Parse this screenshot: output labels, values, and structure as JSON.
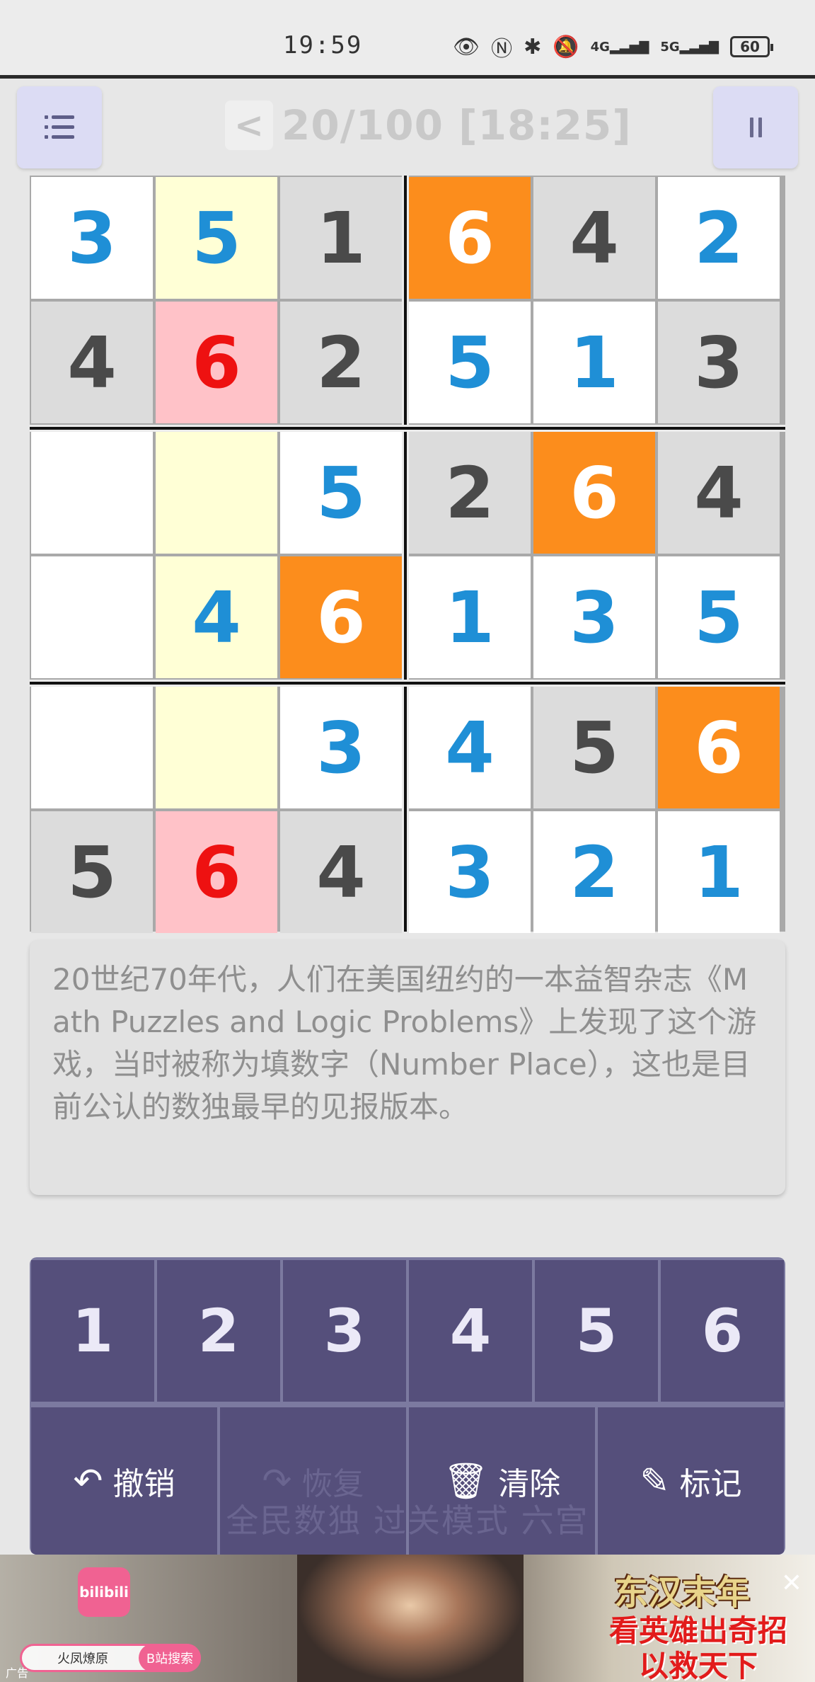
{
  "status_bar": {
    "time": "19:59",
    "network_4g": "4G",
    "network_5g": "5G",
    "battery": "60"
  },
  "header": {
    "back_label": "<",
    "progress": "20/100 [18:25]"
  },
  "board": {
    "size": 6,
    "cells": [
      [
        {
          "v": "3",
          "bg": "#ffffff",
          "fg": "#1f8fd6"
        },
        {
          "v": "5",
          "bg": "#ffffd6",
          "fg": "#1f8fd6"
        },
        {
          "v": "1",
          "bg": "#dcdcdc",
          "fg": "#4a4a4a"
        },
        {
          "v": "6",
          "bg": "#fc8d1c",
          "fg": "#ffffff"
        },
        {
          "v": "4",
          "bg": "#dcdcdc",
          "fg": "#4a4a4a"
        },
        {
          "v": "2",
          "bg": "#ffffff",
          "fg": "#1f8fd6"
        }
      ],
      [
        {
          "v": "4",
          "bg": "#dcdcdc",
          "fg": "#4a4a4a"
        },
        {
          "v": "6",
          "bg": "#ffc2c8",
          "fg": "#ee1111"
        },
        {
          "v": "2",
          "bg": "#dcdcdc",
          "fg": "#4a4a4a"
        },
        {
          "v": "5",
          "bg": "#ffffff",
          "fg": "#1f8fd6"
        },
        {
          "v": "1",
          "bg": "#ffffff",
          "fg": "#1f8fd6"
        },
        {
          "v": "3",
          "bg": "#dcdcdc",
          "fg": "#4a4a4a"
        }
      ],
      [
        {
          "v": "",
          "bg": "#ffffff",
          "fg": "#1f8fd6"
        },
        {
          "v": "",
          "bg": "#ffffd6",
          "fg": "#1f8fd6"
        },
        {
          "v": "5",
          "bg": "#ffffff",
          "fg": "#1f8fd6"
        },
        {
          "v": "2",
          "bg": "#dcdcdc",
          "fg": "#4a4a4a"
        },
        {
          "v": "6",
          "bg": "#fc8d1c",
          "fg": "#ffffff"
        },
        {
          "v": "4",
          "bg": "#dcdcdc",
          "fg": "#4a4a4a"
        }
      ],
      [
        {
          "v": "",
          "bg": "#ffffff",
          "fg": "#1f8fd6"
        },
        {
          "v": "4",
          "bg": "#ffffd6",
          "fg": "#1f8fd6"
        },
        {
          "v": "6",
          "bg": "#fc8d1c",
          "fg": "#ffffff"
        },
        {
          "v": "1",
          "bg": "#ffffff",
          "fg": "#1f8fd6"
        },
        {
          "v": "3",
          "bg": "#ffffff",
          "fg": "#1f8fd6"
        },
        {
          "v": "5",
          "bg": "#ffffff",
          "fg": "#1f8fd6"
        }
      ],
      [
        {
          "v": "",
          "bg": "#ffffff",
          "fg": "#1f8fd6"
        },
        {
          "v": "",
          "bg": "#ffffd6",
          "fg": "#1f8fd6"
        },
        {
          "v": "3",
          "bg": "#ffffff",
          "fg": "#1f8fd6"
        },
        {
          "v": "4",
          "bg": "#ffffff",
          "fg": "#1f8fd6"
        },
        {
          "v": "5",
          "bg": "#dcdcdc",
          "fg": "#4a4a4a"
        },
        {
          "v": "6",
          "bg": "#fc8d1c",
          "fg": "#ffffff"
        }
      ],
      [
        {
          "v": "5",
          "bg": "#dcdcdc",
          "fg": "#4a4a4a"
        },
        {
          "v": "6",
          "bg": "#ffc2c8",
          "fg": "#ee1111"
        },
        {
          "v": "4",
          "bg": "#dcdcdc",
          "fg": "#4a4a4a"
        },
        {
          "v": "3",
          "bg": "#ffffff",
          "fg": "#1f8fd6"
        },
        {
          "v": "2",
          "bg": "#ffffff",
          "fg": "#1f8fd6"
        },
        {
          "v": "1",
          "bg": "#ffffff",
          "fg": "#1f8fd6"
        }
      ]
    ]
  },
  "hint": {
    "text": "20世纪70年代，人们在美国纽约的一本益智杂志《Math Puzzles and Logic Problems》上发现了这个游戏，当时被称为填数字（Number Place），这也是目前公认的数独最早的见报版本。"
  },
  "keypad": {
    "numbers": [
      "1",
      "2",
      "3",
      "4",
      "5",
      "6"
    ],
    "actions": [
      {
        "icon": "undo-icon",
        "glyph": "↶",
        "label": "撤销",
        "enabled": true
      },
      {
        "icon": "redo-icon",
        "glyph": "↷",
        "label": "恢复",
        "enabled": false
      },
      {
        "icon": "trash-icon",
        "glyph": "🗑",
        "label": "清除",
        "enabled": true
      },
      {
        "icon": "pencil-icon",
        "glyph": "✎",
        "label": "标记",
        "enabled": true
      }
    ]
  },
  "watermark": "全民数独 过关模式 六宫",
  "ad": {
    "logo": "bilibili",
    "search_placeholder": "火凤燎原",
    "search_button": "B站搜索",
    "tag": "广告",
    "title": "东汉末年",
    "subtitle_1": "看英雄出奇招",
    "subtitle_2": "以救天下",
    "close": "✕"
  }
}
